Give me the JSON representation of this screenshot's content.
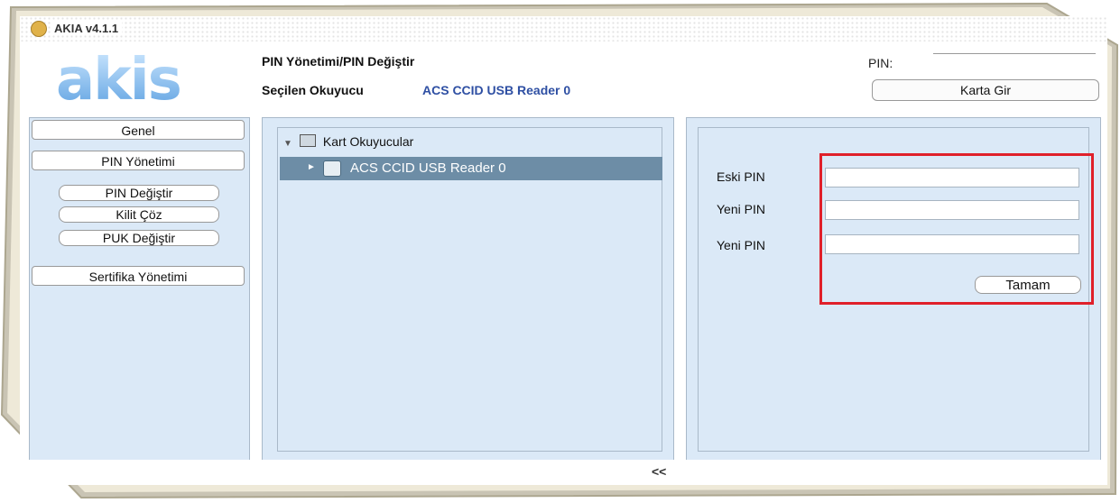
{
  "app": {
    "title": "AKIA v4.1.1"
  },
  "logo": {
    "text": "akis"
  },
  "header": {
    "title": "PIN Yönetimi/PIN Değiştir",
    "reader_label": "Seçilen Okuyucu",
    "reader_value": "ACS CCID USB Reader 0",
    "pin_label": "PIN:",
    "karta_gir_label": "Karta Gir"
  },
  "sidebar": {
    "categories": [
      "Genel",
      "PIN Yönetimi",
      "Sertifika Yönetimi"
    ],
    "pin_actions": [
      "PIN Değiştir",
      "Kilit Çöz",
      "PUK Değiştir"
    ]
  },
  "tree": {
    "root": "Kart Okuyucular",
    "items": [
      "ACS CCID USB Reader 0"
    ]
  },
  "form": {
    "labels": [
      "Eski PIN",
      "Yeni PIN",
      "Yeni PIN"
    ],
    "submit_label": "Tamam"
  },
  "footer": {
    "collapse_label": "<<"
  },
  "colors": {
    "accent": "#2e4fa3",
    "panel": "#dbe9f7",
    "selection": "#6d8da6",
    "highlight": "#e0202a"
  }
}
